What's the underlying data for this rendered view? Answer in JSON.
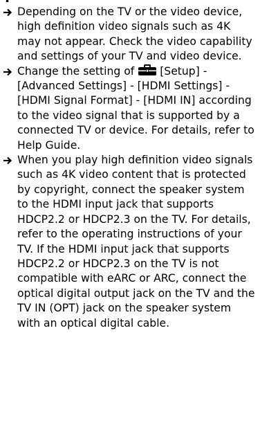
{
  "page": {
    "top_partial_text": "Y"
  },
  "bullets": {
    "item1": {
      "text": "Depending on the TV or the video device, high definition video signals such as 4K may not appear. Check the video capability and settings of your TV and video device."
    },
    "item2": {
      "prefix": "Change the setting of ",
      "icon": "toolbox-icon",
      "suffix": "[Setup] - [Advanced Settings] - [HDMI Settings] - [HDMI Signal Format] - [HDMI IN] according to the video signal that is supported by a connected TV or device. For details, refer to Help Guide."
    },
    "item3": {
      "text": "When you play high definition video signals such as 4K video content that is protected by copyright, connect the speaker system to the HDMI input jack that supports HDCP2.2 or HDCP2.3 on the TV. For details, refer to the operating instructions of your TV. If the HDMI input jack that supports HDCP2.2 or HDCP2.3 on the TV is not compatible with eARC or ARC, connect the optical digital output jack on the TV and the TV IN (OPT) jack on the speaker system with an optical digital cable."
    }
  },
  "colors": {
    "text": "#000000",
    "background": "#ffffff"
  }
}
